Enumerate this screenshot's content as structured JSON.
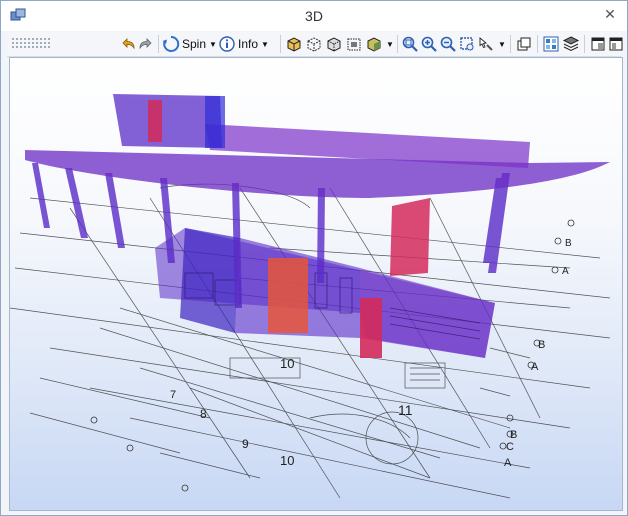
{
  "window": {
    "title": "3D"
  },
  "toolbar": {
    "spin_label": "Spin",
    "info_label": "Info"
  },
  "scene": {
    "grid_numbers": [
      "10",
      "9",
      "8",
      "7",
      "10",
      "11"
    ],
    "grid_letters": [
      "B",
      "A",
      "A",
      "B",
      "C",
      "B",
      "A"
    ]
  },
  "colors": {
    "roof": "#6a2bc4",
    "column": "#5a2cc8",
    "accent_red": "#d42a5a",
    "orange": "#e8553a",
    "grid_line": "#2b2b2b"
  }
}
